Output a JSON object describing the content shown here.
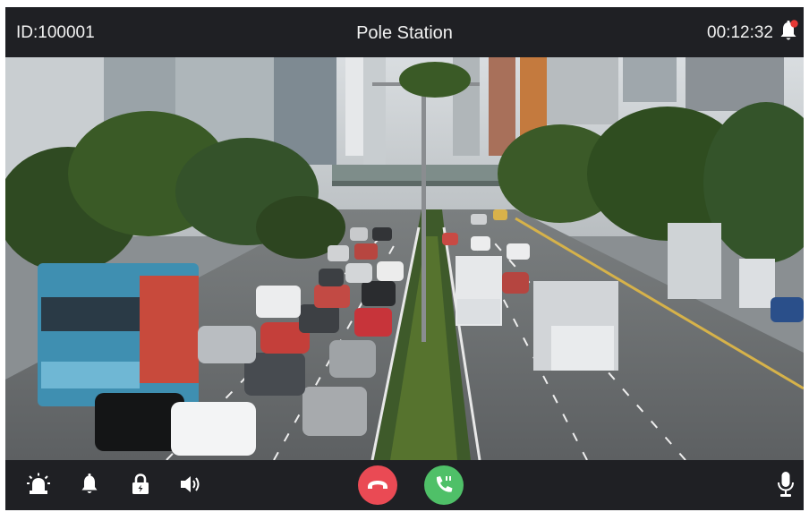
{
  "header": {
    "device_id": "ID:100001",
    "title": "Pole Station",
    "timer": "00:12:32",
    "notification_icon": "bell-icon",
    "notification_badge_color": "#e53935"
  },
  "video": {
    "content": "traffic-camera-feed"
  },
  "toolbar": {
    "icons": [
      "alarm-light-icon",
      "bell-icon",
      "lock-icon",
      "speaker-icon"
    ],
    "hangup_icon": "phone-hangup-icon",
    "answer_icon": "phone-answer-icon",
    "mic_icon": "microphone-icon",
    "hangup_color": "#ea4a54",
    "answer_color": "#4fc068"
  }
}
